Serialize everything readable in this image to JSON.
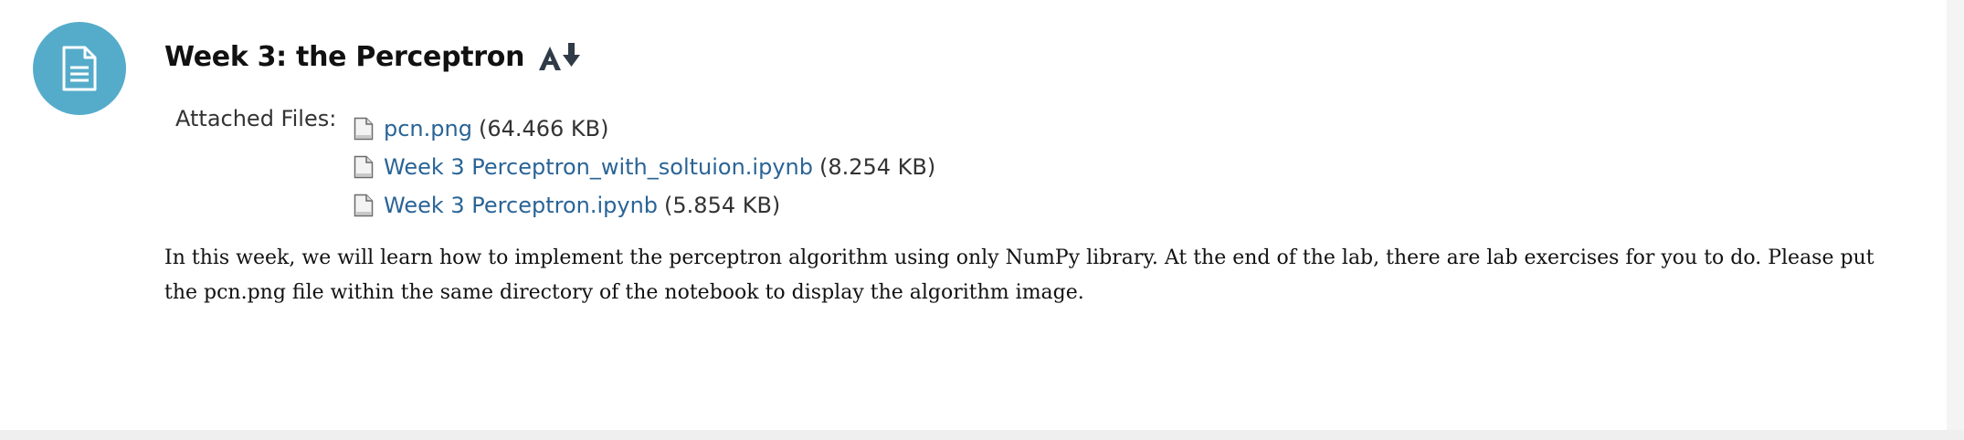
{
  "item": {
    "title": "Week 3: the Perceptron",
    "icon": "document-icon",
    "icon_color": "#55acca",
    "alt_format_icon": "alternative-formats-icon"
  },
  "attachments": {
    "label": "Attached Files:",
    "files": [
      {
        "name": "pcn.png",
        "size": "(64.466 KB)"
      },
      {
        "name": "Week 3 Perceptron_with_soltuion.ipynb",
        "size": "(8.254 KB)"
      },
      {
        "name": "Week 3 Perceptron.ipynb",
        "size": "(5.854 KB)"
      }
    ]
  },
  "description": "In this week, we will learn how to implement the perceptron algorithm using only NumPy library. At the end of the lab, there are lab exercises for you to do. Please put the pcn.png file within the same directory of the notebook to display the algorithm image.",
  "colors": {
    "link": "#2a6496",
    "text": "#111111"
  }
}
